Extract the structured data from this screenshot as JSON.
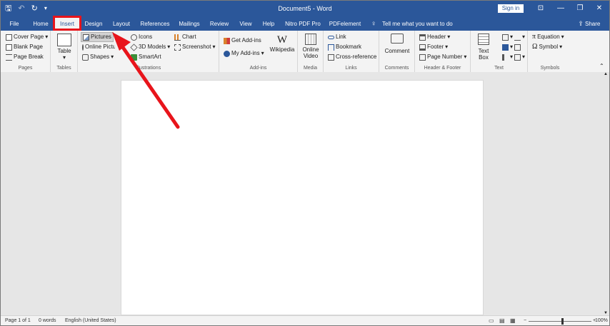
{
  "window": {
    "title": "Document5 - Word",
    "signin_label": "Sign in",
    "minimize": "—",
    "restore": "❐",
    "close": "✕"
  },
  "quick_access": {
    "save": "🖫",
    "undo": "↶",
    "redo": "↻",
    "customize": "▾"
  },
  "tabs": [
    {
      "label": "File"
    },
    {
      "label": "Home"
    },
    {
      "label": "Insert"
    },
    {
      "label": "Design"
    },
    {
      "label": "Layout"
    },
    {
      "label": "References"
    },
    {
      "label": "Mailings"
    },
    {
      "label": "Review"
    },
    {
      "label": "View"
    },
    {
      "label": "Help"
    },
    {
      "label": "Nitro PDF Pro"
    },
    {
      "label": "PDFelement"
    }
  ],
  "tell_me": "Tell me what you want to do",
  "share": "Share",
  "ribbon": {
    "pages": {
      "label": "Pages",
      "cover_page": "Cover Page",
      "blank_page": "Blank Page",
      "page_break": "Page Break"
    },
    "tables": {
      "label": "Tables",
      "table": "Table"
    },
    "illustrations": {
      "label": "Illustrations",
      "pictures": "Pictures",
      "online_pictures": "Online Pictures",
      "shapes": "Shapes",
      "icons": "Icons",
      "models_3d": "3D Models",
      "smartart": "SmartArt",
      "chart": "Chart",
      "screenshot": "Screenshot"
    },
    "addins": {
      "label": "Add-ins",
      "get_addins": "Get Add-ins",
      "my_addins": "My Add-ins",
      "wikipedia": "Wikipedia"
    },
    "media": {
      "label": "Media",
      "online_video_1": "Online",
      "online_video_2": "Video"
    },
    "links": {
      "label": "Links",
      "link": "Link",
      "bookmark": "Bookmark",
      "cross_reference": "Cross-reference"
    },
    "comments": {
      "label": "Comments",
      "comment": "Comment"
    },
    "header_footer": {
      "label": "Header & Footer",
      "header": "Header",
      "footer": "Footer",
      "page_number": "Page Number"
    },
    "text": {
      "label": "Text",
      "text_box_1": "Text",
      "text_box_2": "Box"
    },
    "symbols": {
      "label": "Symbols",
      "equation": "Equation",
      "symbol": "Symbol"
    }
  },
  "status": {
    "page": "Page 1 of 1",
    "words": "0 words",
    "language": "English (United States)",
    "zoom": "100%",
    "zoom_out": "−",
    "zoom_in": "+"
  },
  "colors": {
    "brand": "#2b579a",
    "highlight": "#e8141b"
  }
}
